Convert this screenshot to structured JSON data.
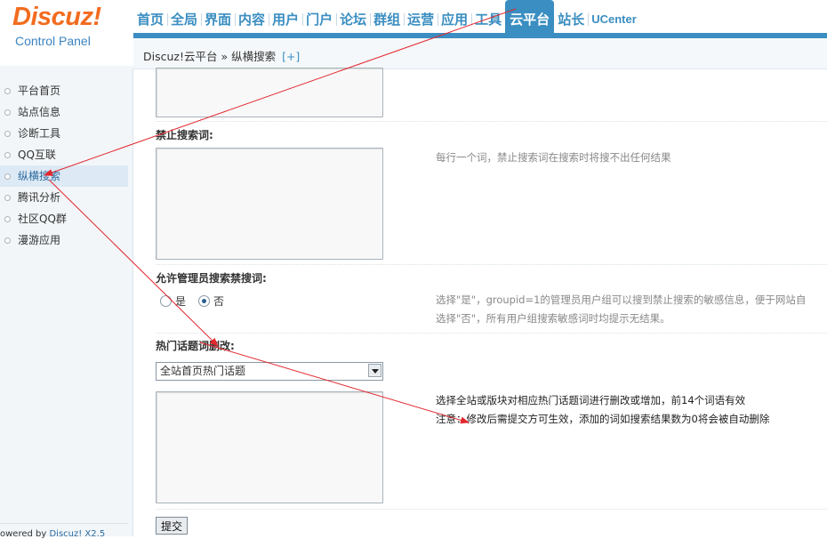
{
  "logo": {
    "brand": "Discuz!",
    "subtitle": "Control Panel"
  },
  "topnav": {
    "items": [
      "首页",
      "全局",
      "界面",
      "内容",
      "用户",
      "门户",
      "论坛",
      "群组",
      "运营",
      "应用",
      "工具",
      "云平台",
      "站长",
      "UCenter"
    ],
    "active": "云平台"
  },
  "breadcrumb": {
    "text": "Discuz!云平台 » 纵横搜索",
    "plus": "[+]"
  },
  "sidebar": {
    "items": [
      "平台首页",
      "站点信息",
      "诊断工具",
      "QQ互联",
      "纵横搜索",
      "腾讯分析",
      "社区QQ群",
      "漫游应用"
    ],
    "active": "纵横搜索",
    "footer_prefix": "owered by ",
    "footer_brand": "Discuz! X2.5"
  },
  "form": {
    "ban_words": {
      "label": "禁止搜索词:",
      "tip": "每行一个词，禁止搜索词在搜索时将搜不出任何结果"
    },
    "admin_search": {
      "label": "允许管理员搜索禁搜词:",
      "yes": "是",
      "no": "否",
      "selected": "否",
      "tip_line1": "选择\"是\"，groupid=1的管理员用户组可以搜到禁止搜索的敏感信息，便于网站自",
      "tip_line2": "选择\"否\"，所有用户组搜索敏感词时均提示无结果。"
    },
    "hot_topics": {
      "label": "热门话题词删改:",
      "select_value": "全站首页热门话题",
      "tip_line1": "选择全站或版块对相应热门话题词进行删改或增加，前14个词语有效",
      "tip_line2": "注意：修改后需提交方可生效，添加的词如搜索结果数为0将会被自动删除"
    },
    "submit_label": "提交"
  },
  "colors": {
    "brand_orange": "#f26c1f",
    "nav_blue": "#3a8ec1",
    "annotation_red": "#e3262c"
  }
}
